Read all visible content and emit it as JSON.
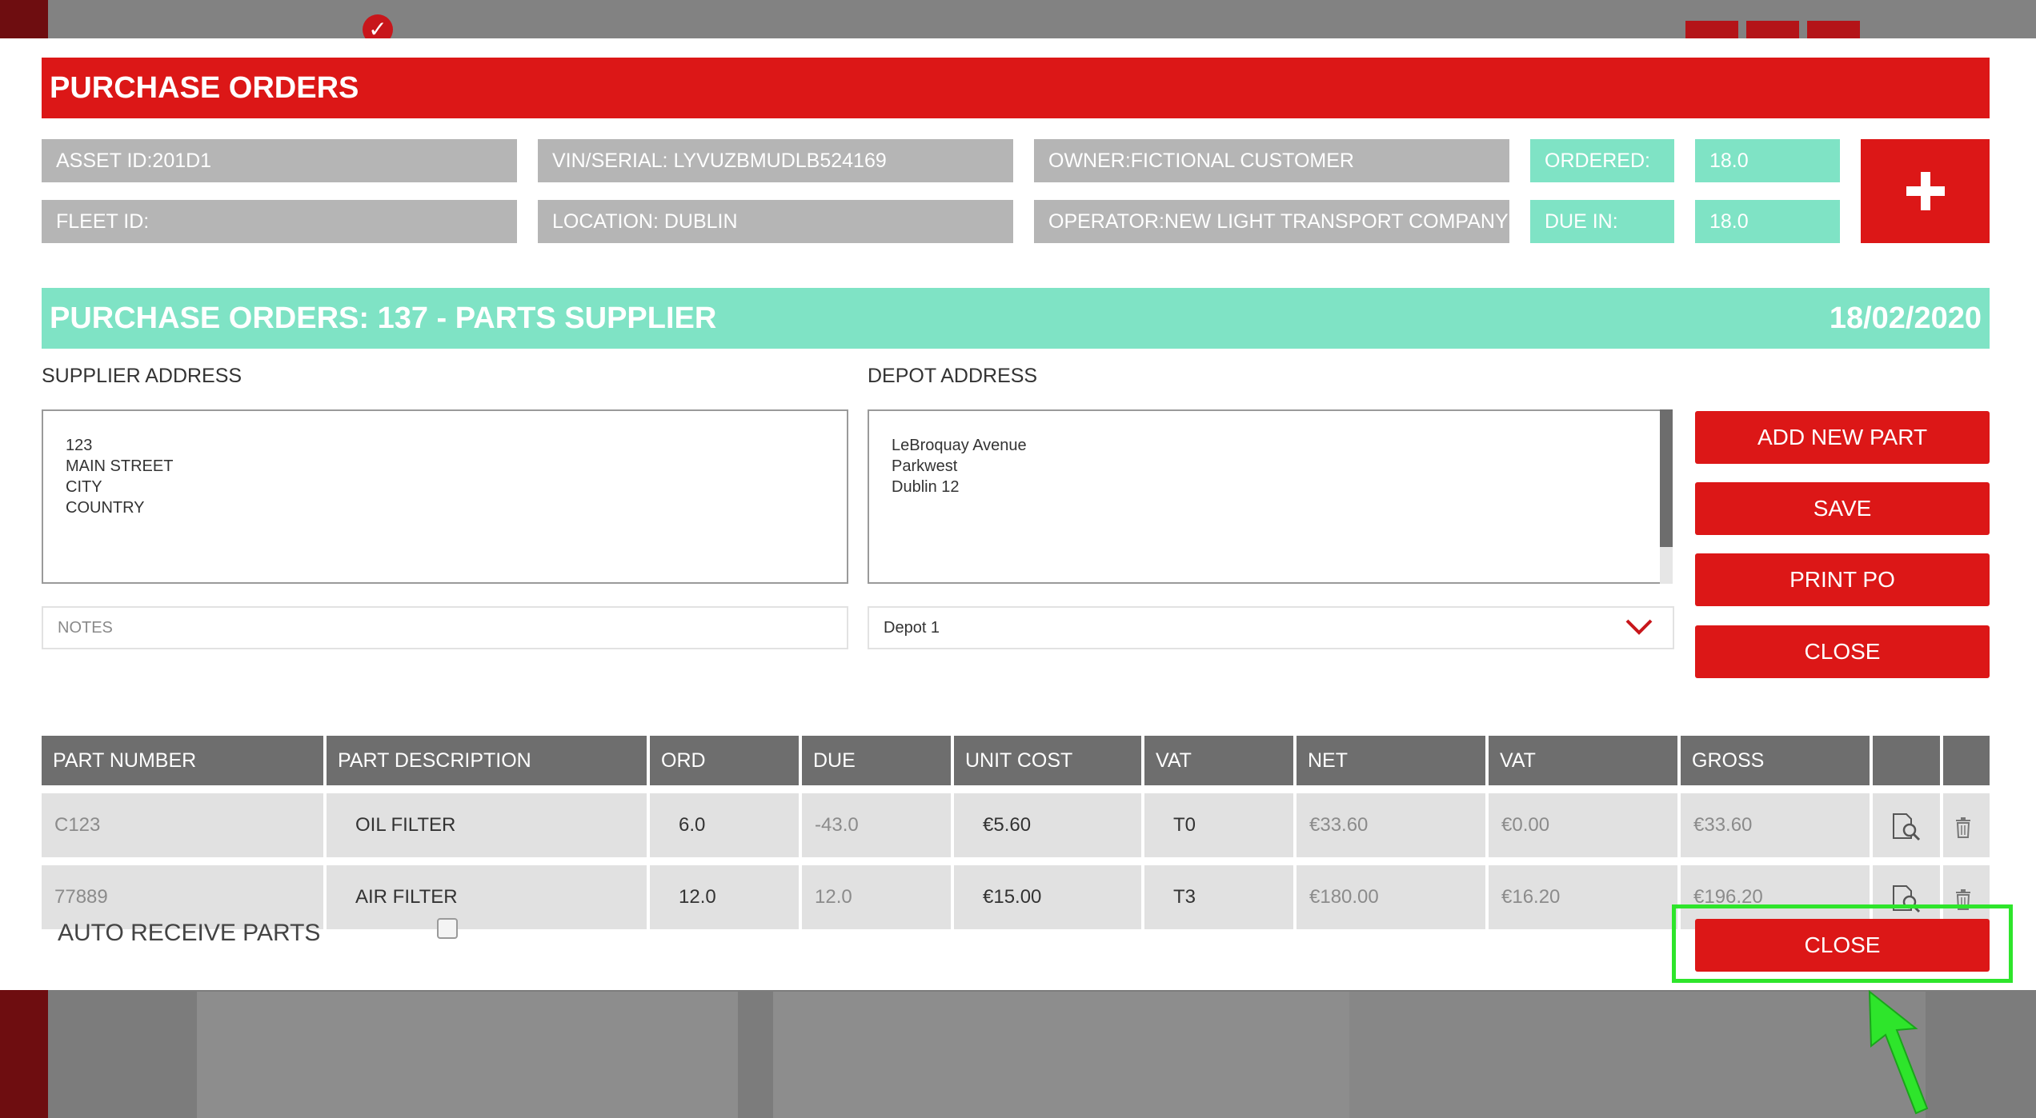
{
  "modal": {
    "title": "PURCHASE ORDERS",
    "info": {
      "asset_id": "ASSET ID:201D1",
      "vin": "VIN/SERIAL: LYVUZBMUDLB524169",
      "owner": "OWNER:FICTIONAL CUSTOMER",
      "ordered_label": "ORDERED:",
      "ordered_value": "18.0",
      "fleet_id": "FLEET ID:",
      "location": "LOCATION: DUBLIN",
      "operator": "OPERATOR:NEW LIGHT TRANSPORT COMPANY",
      "due_label": "DUE IN:",
      "due_value": "18.0"
    },
    "po_header": {
      "title": "PURCHASE ORDERS: 137 - PARTS SUPPLIER",
      "date": "18/02/2020"
    },
    "supplier": {
      "label": "SUPPLIER ADDRESS",
      "lines": [
        "123",
        "MAIN STREET",
        "CITY",
        "COUNTRY"
      ]
    },
    "depot": {
      "label": "DEPOT ADDRESS",
      "lines": [
        "LeBroquay Avenue",
        "Parkwest",
        "Dublin 12"
      ],
      "selected": "Depot 1"
    },
    "notes_placeholder": "NOTES",
    "buttons": {
      "add_new_part": "ADD NEW PART",
      "save": "SAVE",
      "print_po": "PRINT PO",
      "close": "CLOSE",
      "close_bottom": "CLOSE"
    },
    "table": {
      "headers": [
        "PART NUMBER",
        "PART DESCRIPTION",
        "ORD",
        "DUE",
        "UNIT COST",
        "VAT",
        "NET",
        "VAT",
        "GROSS"
      ],
      "rows": [
        {
          "part_number": "C123",
          "description": "OIL FILTER",
          "ord": "6.0",
          "due": "-43.0",
          "unit_cost": "€5.60",
          "vat_code": "T0",
          "net": "€33.60",
          "vat": "€0.00",
          "gross": "€33.60"
        },
        {
          "part_number": "77889",
          "description": "AIR FILTER",
          "ord": "12.0",
          "due": "12.0",
          "unit_cost": "€15.00",
          "vat_code": "T3",
          "net": "€180.00",
          "vat": "€16.20",
          "gross": "€196.20"
        }
      ]
    },
    "auto_receive_label": "AUTO RECEIVE PARTS"
  },
  "colors": {
    "brand_red": "#dc1717",
    "teal": "#7fe3c5",
    "highlight_green": "#2ee52b"
  },
  "icons": [
    "check-icon",
    "plus-icon",
    "chevron-down-icon",
    "view-icon",
    "trash-icon",
    "arrow-pointer-icon"
  ]
}
